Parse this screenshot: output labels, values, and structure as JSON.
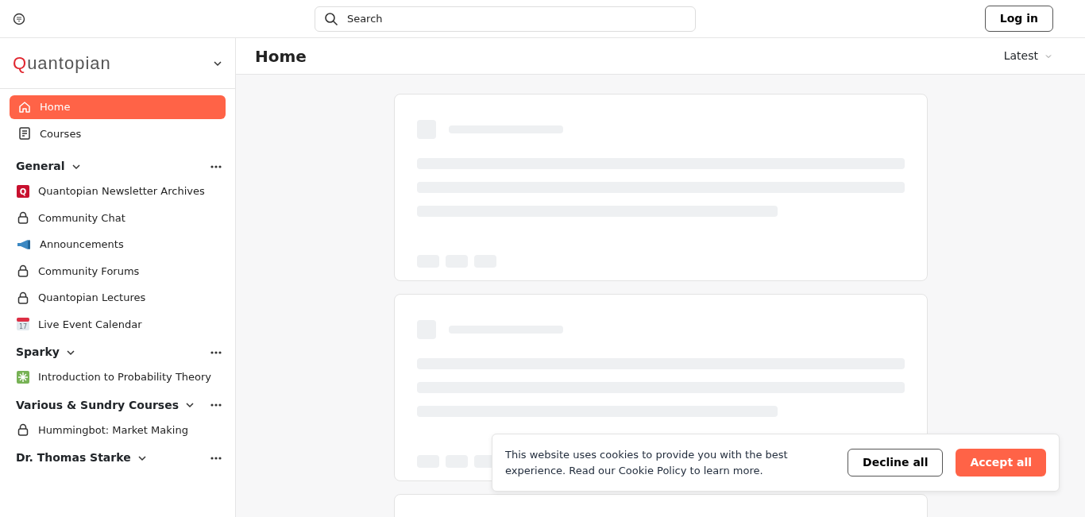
{
  "topbar": {
    "search": {
      "placeholder": "Search"
    },
    "login_button": "Log in"
  },
  "sidebar": {
    "brand": "Quantopian",
    "nav": [
      {
        "label": "Home",
        "kind": "home",
        "selected": true
      },
      {
        "label": "Courses",
        "kind": "notebook",
        "selected": false
      }
    ],
    "sections": [
      {
        "title": "General",
        "expanded": true,
        "items": [
          {
            "label": "Quantopian Newsletter Archives",
            "kind": "badge",
            "badge_text": "Q"
          },
          {
            "label": "Community Chat",
            "kind": "lock"
          },
          {
            "label": "Announcements",
            "kind": "megaphone"
          },
          {
            "label": "Community Forums",
            "kind": "lock"
          },
          {
            "label": "Quantopian Lectures",
            "kind": "lock"
          },
          {
            "label": "Live Event Calendar",
            "kind": "calendar",
            "badge_text": "17"
          }
        ]
      },
      {
        "title": "Sparky",
        "expanded": true,
        "items": [
          {
            "label": "Introduction to Probability Theory",
            "kind": "sparkle"
          }
        ]
      },
      {
        "title": "Various & Sundry Courses",
        "expanded": true,
        "items": [
          {
            "label": "Hummingbot: Market Making",
            "kind": "lock"
          }
        ]
      },
      {
        "title": "Dr. Thomas Starke",
        "expanded": true
      }
    ]
  },
  "main": {
    "title": "Home",
    "sort": "Latest"
  },
  "cookie_banner": {
    "text": "This website uses cookies to provide you with the best experience. Read our Cookie Policy to learn more.",
    "decline": "Decline all",
    "accept": "Accept all"
  }
}
